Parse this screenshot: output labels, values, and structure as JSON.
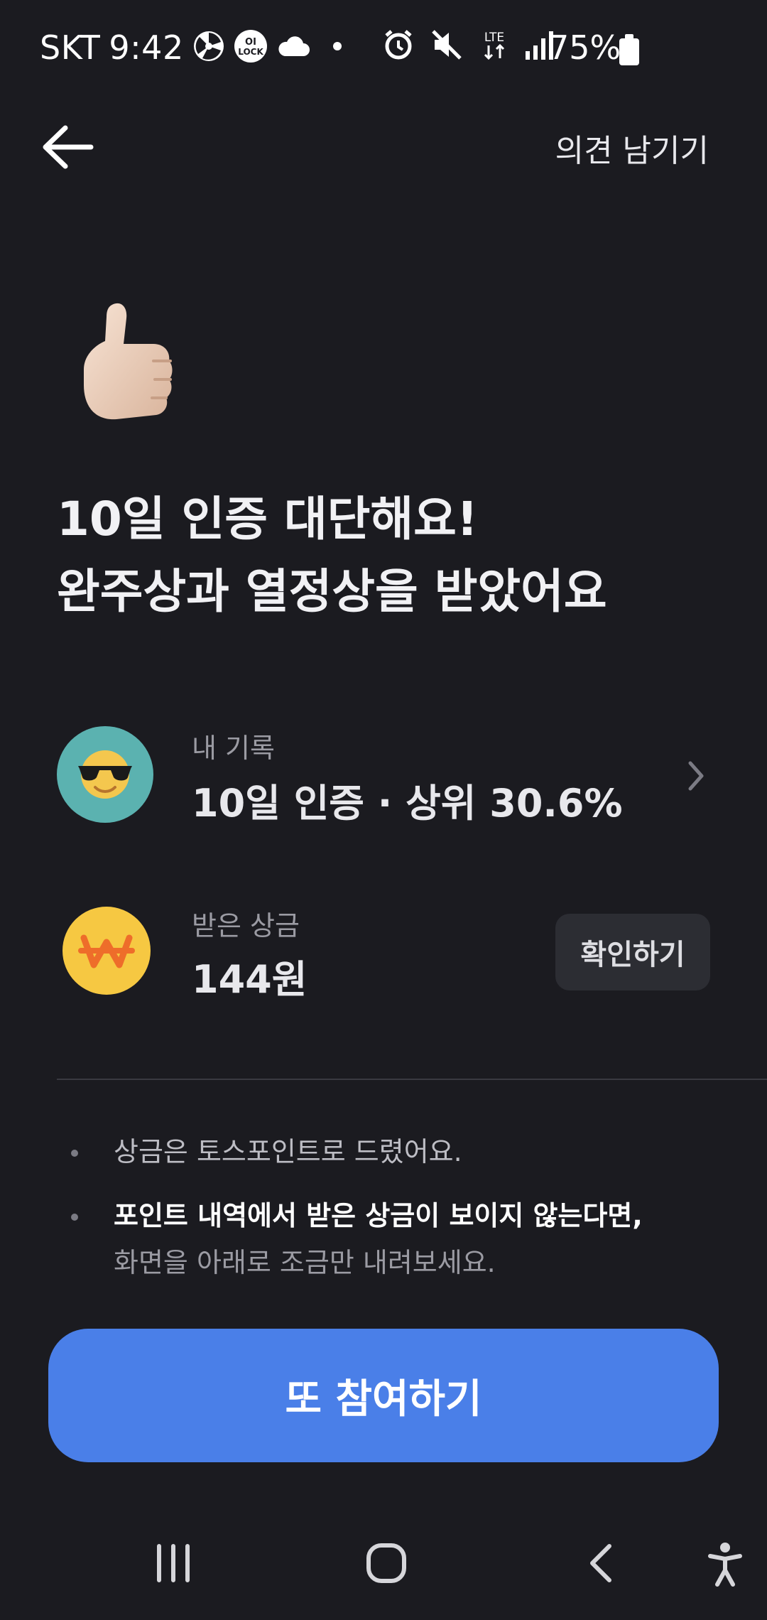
{
  "status_bar": {
    "carrier": "SKT",
    "time": "9:42",
    "lock_badge": "OI LOCK",
    "network": "LTE",
    "battery": "75%",
    "icons": [
      "sphere-icon",
      "lock-app-icon",
      "cloud-icon",
      "dot-icon",
      "alarm-icon",
      "mute-icon",
      "lte-icon",
      "signal-icon",
      "battery-icon"
    ]
  },
  "header": {
    "back_icon": "arrow-left-icon",
    "feedback_label": "의견 남기기"
  },
  "hero": {
    "emoji": "thumbs-up-icon",
    "line1": "10일 인증 대단해요!",
    "line2": "완주상과 열정상을 받았어요"
  },
  "record": {
    "label": "내 기록",
    "value": "10일 인증 · 상위 30.6%",
    "icon": "sunglasses-face-icon"
  },
  "prize": {
    "label": "받은 상금",
    "value": "144원",
    "button_label": "확인하기",
    "icon": "won-coin-icon"
  },
  "notes": {
    "item1": "상금은 토스포인트로 드렸어요.",
    "item2_strong": "포인트 내역에서 받은 상금이 보이지 않는다면,",
    "item2_sub": "화면을 아래로 조금만 내려보세요."
  },
  "cta": {
    "label": "또 참여하기"
  },
  "colors": {
    "background": "#1b1b20",
    "accent": "#4a7fe8",
    "coin": "#f6c842",
    "avatar": "#5bb2b0"
  },
  "nav_bar": {
    "icons": [
      "recent-apps-icon",
      "home-icon",
      "back-icon",
      "accessibility-icon"
    ]
  }
}
